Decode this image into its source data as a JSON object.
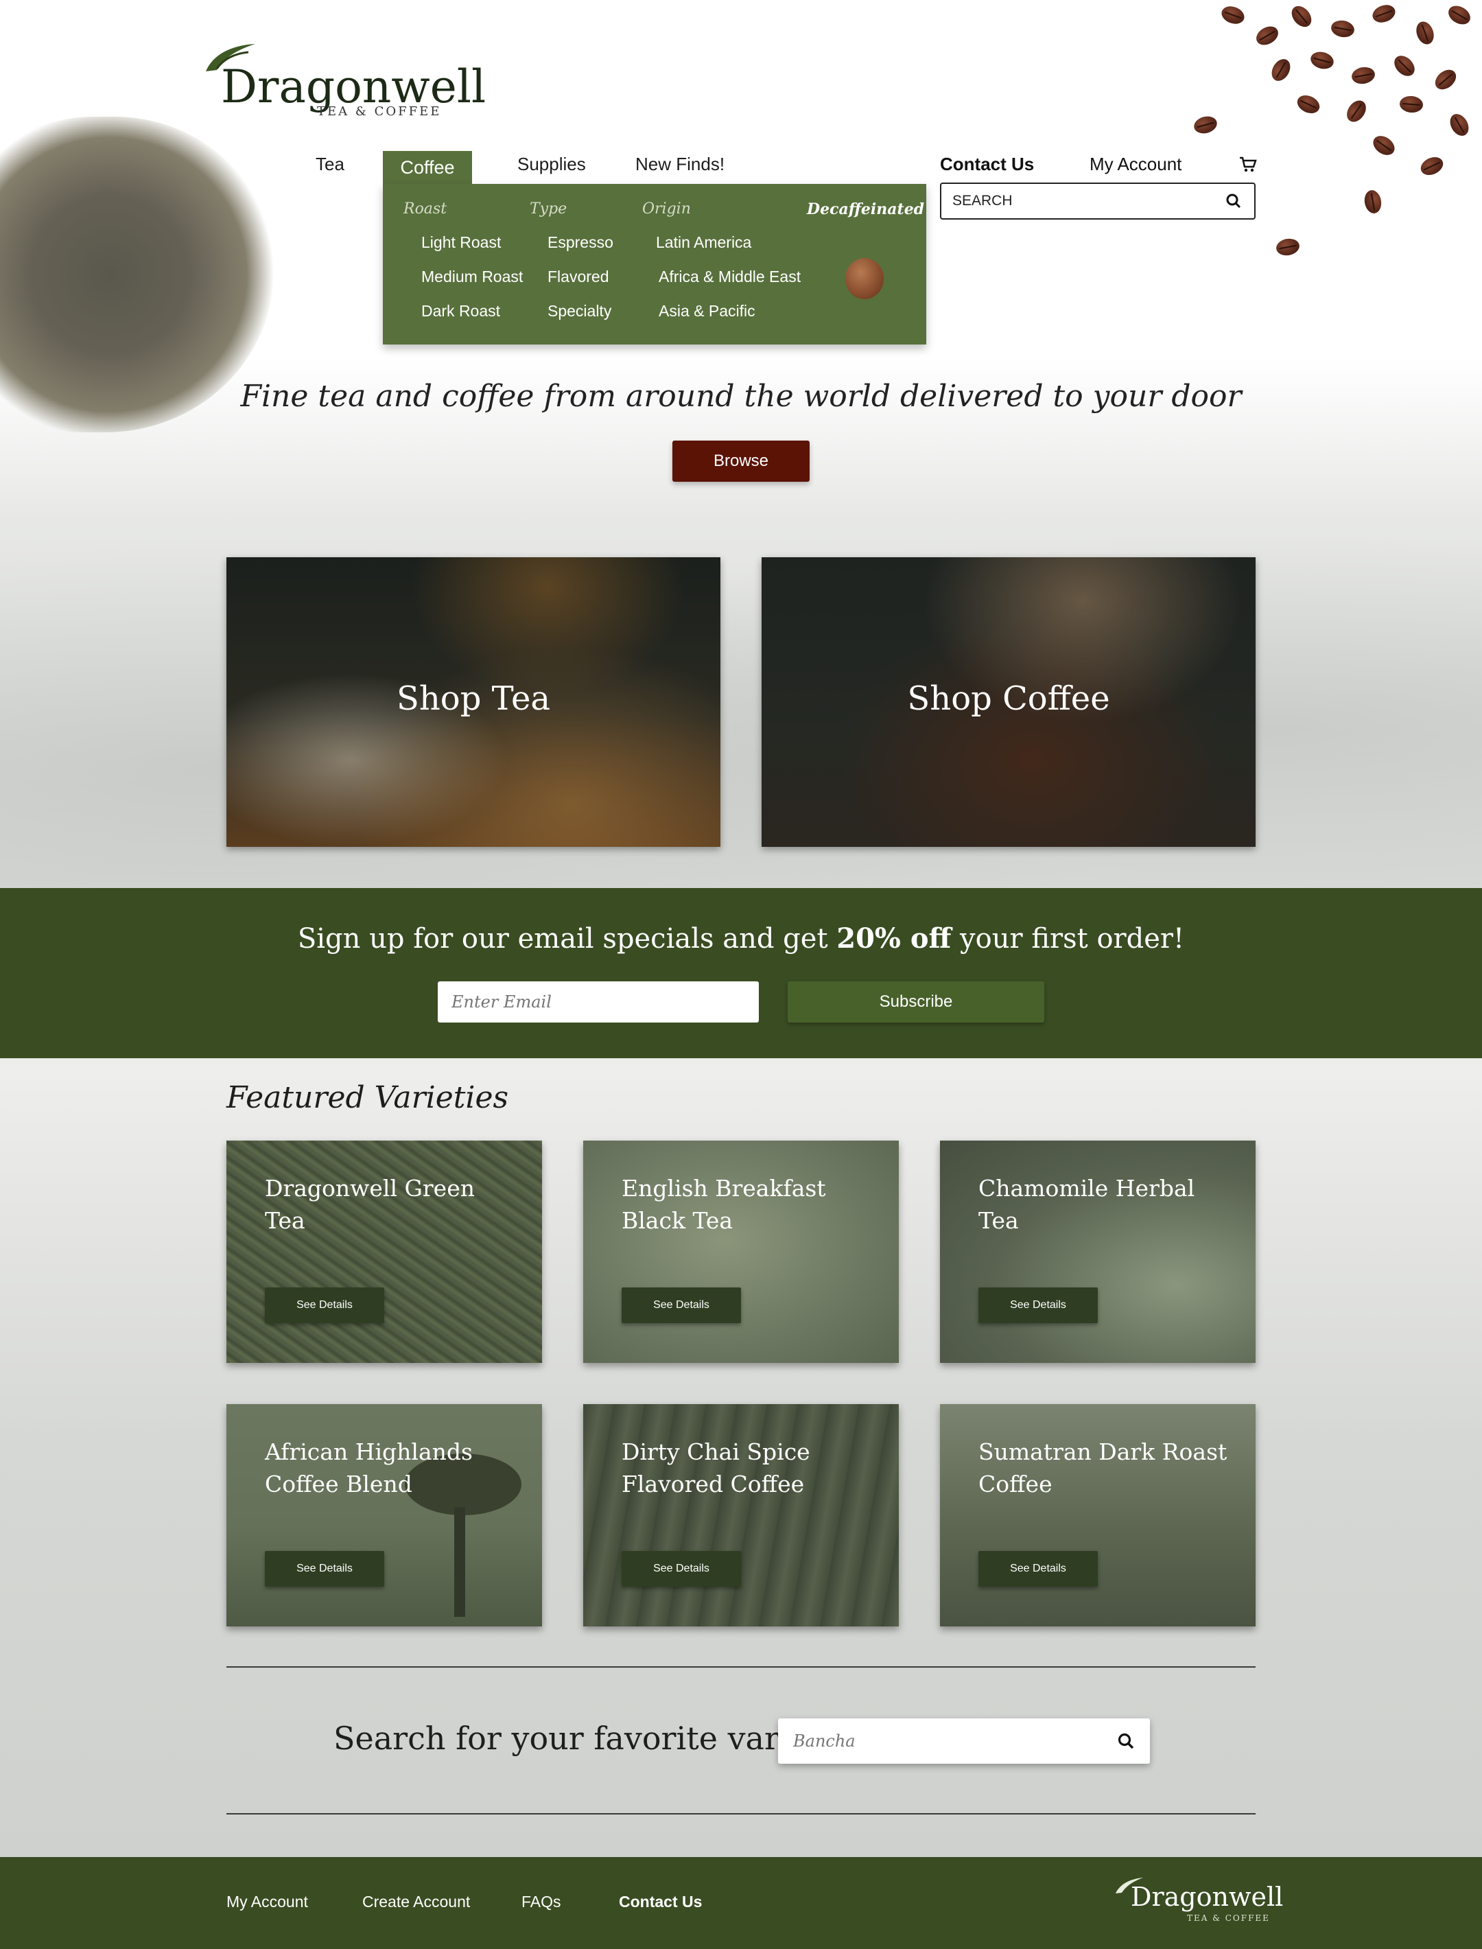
{
  "brand": {
    "name": "Dragonwell",
    "tagline": "TEA & COFFEE"
  },
  "nav": {
    "items": [
      {
        "label": "Tea"
      },
      {
        "label": "Coffee",
        "active": true
      },
      {
        "label": "Supplies"
      },
      {
        "label": "New Finds!"
      }
    ],
    "contact": "Contact Us",
    "account": "My Account",
    "cart_icon": "cart-icon",
    "search": {
      "value": "SEARCH",
      "icon": "search-icon"
    }
  },
  "dropdown": {
    "headings": [
      "Roast",
      "Type",
      "Origin",
      "Decaffeinated"
    ],
    "roast": [
      "Light Roast",
      "Medium Roast",
      "Dark Roast"
    ],
    "type": [
      "Espresso",
      "Flavored",
      "Specialty"
    ],
    "origin": [
      "Latin America",
      "Africa & Middle East",
      "Asia & Pacific"
    ]
  },
  "hero": {
    "tagline": "Fine tea and coffee from around the world delivered to your door",
    "browse": "Browse"
  },
  "shop": {
    "tea": "Shop Tea",
    "coffee": "Shop Coffee"
  },
  "email": {
    "text_before": "Sign up for our email specials and get ",
    "text_bold": "20% off",
    "text_after": " your first order!",
    "placeholder": "Enter Email",
    "button": "Subscribe"
  },
  "featured": {
    "title": "Featured Varieties",
    "button": "See Details",
    "cards": [
      {
        "title": "Dragonwell Green Tea"
      },
      {
        "title": "English Breakfast Black Tea"
      },
      {
        "title": "Chamomile Herbal Tea"
      },
      {
        "title": "African Highlands Coffee Blend"
      },
      {
        "title": "Dirty Chai Spice Flavored Coffee"
      },
      {
        "title": "Sumatran Dark Roast Coffee"
      }
    ]
  },
  "variety_search": {
    "label": "Search for your favorite variety:",
    "placeholder": "Bancha"
  },
  "footer": {
    "links": [
      "My Account",
      "Create Account",
      "FAQs",
      "Contact Us"
    ]
  },
  "colors": {
    "green_dark": "#3a4c22",
    "green_nav": "#58703c",
    "browse_red": "#5b1306"
  }
}
